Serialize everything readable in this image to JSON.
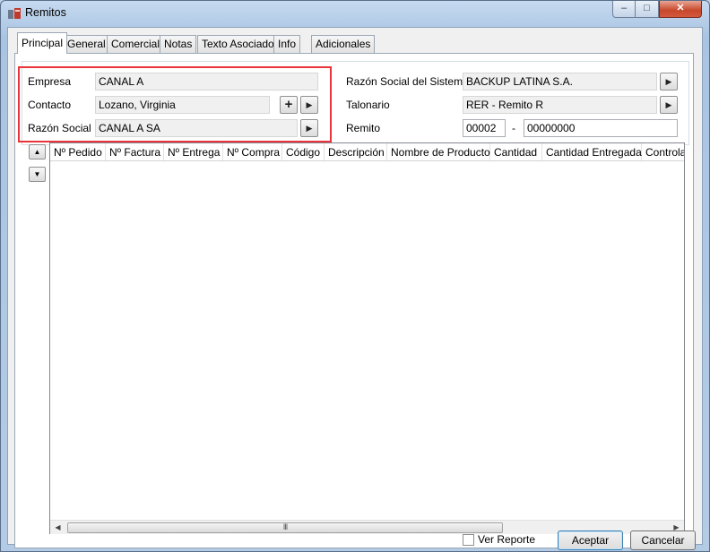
{
  "window": {
    "title": "Remitos",
    "min": "–",
    "max": "□",
    "close": "✕"
  },
  "tabs": [
    "Principal",
    "General",
    "Comercial",
    "Notas",
    "Texto Asociado",
    "Info",
    "Adicionales"
  ],
  "left": {
    "empresa_label": "Empresa",
    "empresa_value": "CANAL A",
    "contacto_label": "Contacto",
    "contacto_value": "Lozano, Virginia",
    "razon_label": "Razón Social",
    "razon_value": "CANAL A SA"
  },
  "right": {
    "razon_sistema_label": "Razón Social del Sistema",
    "razon_sistema_value": "BACKUP LATINA S.A.",
    "talonario_label": "Talonario",
    "talonario_value": "RER - Remito R",
    "remito_label": "Remito",
    "remito_prefix": "00002",
    "remito_sep": "-",
    "remito_number": "00000000"
  },
  "grid": {
    "columns": [
      "Nº Pedido",
      "Nº Factura",
      "Nº Entrega",
      "Nº Compra",
      "Código",
      "Descripción",
      "Nombre de Producto",
      "Cantidad",
      "Cantidad Entregada",
      "Controla"
    ],
    "rows": []
  },
  "icons": {
    "plus": "+",
    "right": "▶",
    "up": "▲",
    "down": "▼",
    "left": "◀",
    "grip": "III"
  },
  "bottom": {
    "ver_reporte": "Ver Reporte",
    "aceptar": "Aceptar",
    "cancelar": "Cancelar"
  }
}
